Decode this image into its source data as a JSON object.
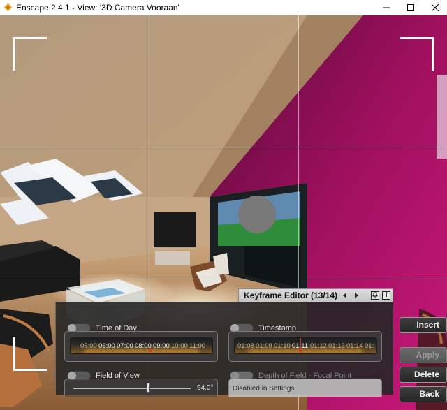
{
  "window": {
    "title": "Enscape 2.4.1 - View: '3D Camera Vooraan'"
  },
  "keyframe_editor": {
    "title": "Keyframe Editor (13/14)",
    "time_of_day": {
      "label": "Time of Day",
      "ticks": [
        "05:00",
        "06:00",
        "07:00",
        "08:00",
        "09:00",
        "10:00",
        "11:00"
      ]
    },
    "timestamp": {
      "label": "Timestamp",
      "ticks": [
        "01:08",
        "01:09",
        "01:10",
        "01:11",
        "01:12",
        "01:13",
        "01:14",
        "01:"
      ]
    },
    "field_of_view": {
      "label": "Field of View",
      "value": "94.0°"
    },
    "depth_of_field": {
      "label": "Depth of Field - Focal Point",
      "status": "Disabled in Settings"
    }
  },
  "actions": {
    "insert": "Insert",
    "apply": "Apply",
    "delete": "Delete",
    "back": "Back"
  },
  "colors": {
    "accent_wall": "#b0106e",
    "panel_bg": "#262626",
    "ruler_highlight": "#d33333"
  }
}
